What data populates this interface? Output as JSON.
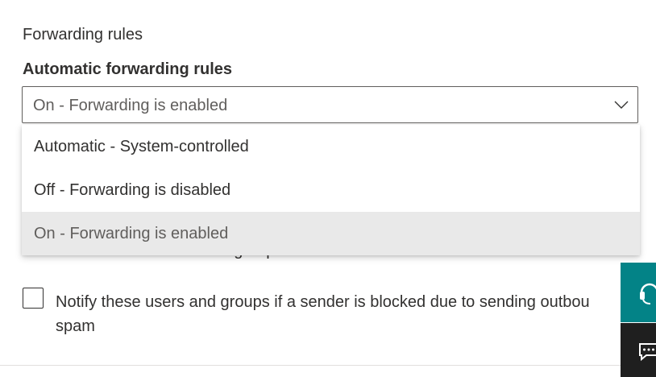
{
  "section_title": "Forwarding rules",
  "field_label": "Automatic forwarding rules",
  "dropdown": {
    "selected_value": "On - Forwarding is enabled",
    "options": [
      "Automatic - System-controlled",
      "Off - Forwarding is disabled",
      "On - Forwarding is enabled"
    ]
  },
  "obscured_text": "limits to these users and groups",
  "notify_checkbox": {
    "label_line1": "Notify these users and groups if a sender is blocked due to sending outbou",
    "label_line2": "spam",
    "checked": false
  },
  "side_buttons": {
    "help_icon": "headset-icon",
    "feedback_icon": "chat-feedback-icon"
  },
  "colors": {
    "accent_teal": "#038387",
    "dark_button": "#1f1f1f",
    "selected_option_bg": "#e9e9e9"
  }
}
